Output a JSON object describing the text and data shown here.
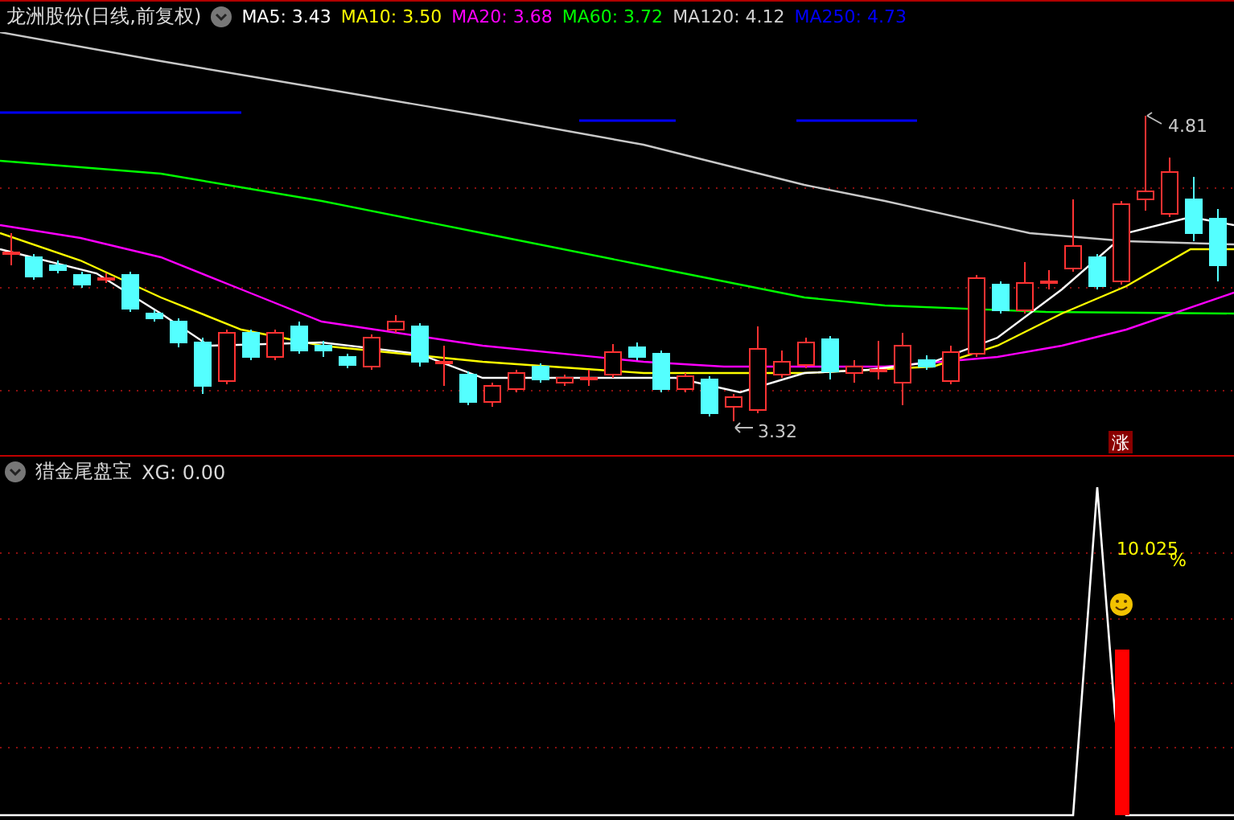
{
  "header": {
    "title": "龙洲股份(日线,前复权)",
    "ma_legend": [
      {
        "label": "MA5: 3.43",
        "color": "#ffffff"
      },
      {
        "label": "MA10: 3.50",
        "color": "#ffff00"
      },
      {
        "label": "MA20: 3.68",
        "color": "#ff00ff"
      },
      {
        "label": "MA60: 3.72",
        "color": "#00ff00"
      },
      {
        "label": "MA120: 4.12",
        "color": "#d0d0d0"
      },
      {
        "label": "MA250: 4.73",
        "color": "#0000ff"
      }
    ]
  },
  "main_chart": {
    "high_label": "4.81",
    "low_label": "3.32",
    "badge": "涨"
  },
  "indicator": {
    "name": "猎金尾盘宝",
    "reading": "XG: 0.00",
    "value_label": "10.025",
    "unit": "%"
  }
}
